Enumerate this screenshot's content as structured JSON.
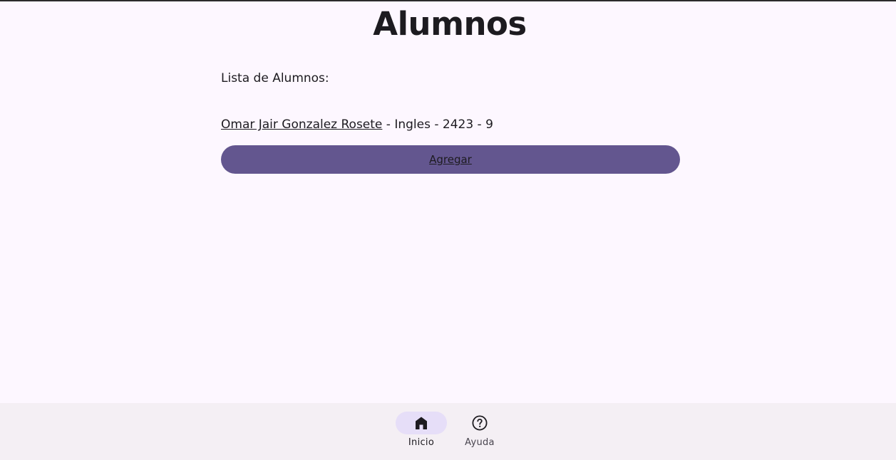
{
  "header": {
    "title": "Alumnos"
  },
  "main": {
    "list_heading": "Lista de Alumnos:",
    "students": [
      {
        "name": "Omar Jair Gonzalez Rosete",
        "details": " - Ingles - 2423 - 9"
      }
    ],
    "add_button_label": "Agregar"
  },
  "bottom_nav": {
    "items": [
      {
        "label": "Inicio",
        "icon": "home-icon",
        "selected": true
      },
      {
        "label": "Ayuda",
        "icon": "help-circle-icon",
        "selected": false
      }
    ]
  },
  "colors": {
    "background": "#fdf7ff",
    "accent_button": "#63568f",
    "nav_background": "#f4eff4",
    "nav_selected_pill": "#e6def8",
    "text": "#1d1b20"
  }
}
